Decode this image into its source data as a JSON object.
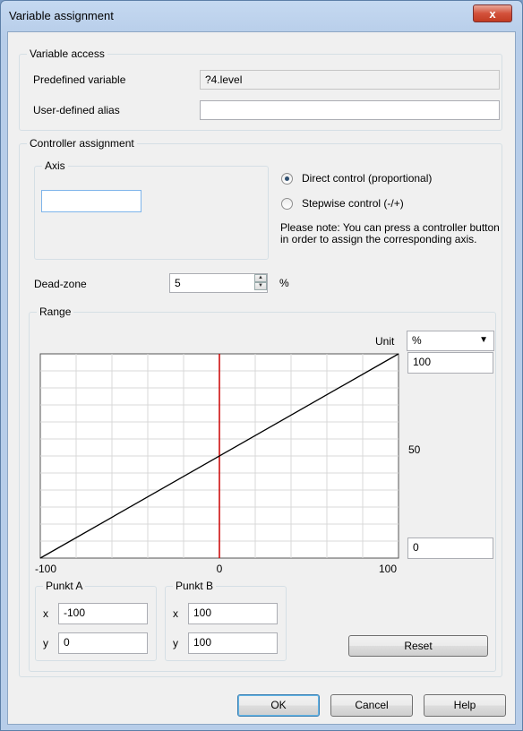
{
  "window": {
    "title": "Variable assignment",
    "close_label": "x"
  },
  "variable_access": {
    "legend": "Variable access",
    "predefined_label": "Predefined variable",
    "predefined_value": "?4.level",
    "alias_label": "User-defined alias",
    "alias_value": ""
  },
  "controller_assignment": {
    "legend": "Controller assignment",
    "axis_legend": "Axis",
    "axis_value": "",
    "direct_label": "Direct control (proportional)",
    "stepwise_label": "Stepwise control (-/+)",
    "selected_mode": "direct",
    "note": "Please note: You can press a controller button in order to assign the corresponding axis.",
    "deadzone_label": "Dead-zone",
    "deadzone_value": "5",
    "deadzone_unit": "%"
  },
  "range": {
    "legend": "Range",
    "unit_label": "Unit",
    "unit_value": "%",
    "y_top": "100",
    "y_mid": "50",
    "y_bottom": "0",
    "x_labels": [
      "-100",
      "0",
      "100"
    ],
    "punkt_a": {
      "legend": "Punkt A",
      "x_label": "x",
      "x_value": "-100",
      "y_label": "y",
      "y_value": "0"
    },
    "punkt_b": {
      "legend": "Punkt B",
      "x_label": "x",
      "x_value": "100",
      "y_label": "y",
      "y_value": "100"
    },
    "reset_label": "Reset"
  },
  "chart_data": {
    "type": "line",
    "x": [
      -100,
      100
    ],
    "series": [
      {
        "values": [
          0,
          100
        ]
      }
    ],
    "xlim": [
      -100,
      100
    ],
    "ylim": [
      0,
      100
    ],
    "x_tick_labels": [
      "-100",
      "0",
      "100"
    ],
    "y_tick_labels": [
      "100",
      "50",
      "0"
    ],
    "marker_x": 0,
    "grid": true,
    "colors": {
      "line": "#000000",
      "marker": "#cc0000",
      "grid": "#d8d8d8"
    }
  },
  "buttons": {
    "ok": "OK",
    "cancel": "Cancel",
    "help": "Help"
  }
}
